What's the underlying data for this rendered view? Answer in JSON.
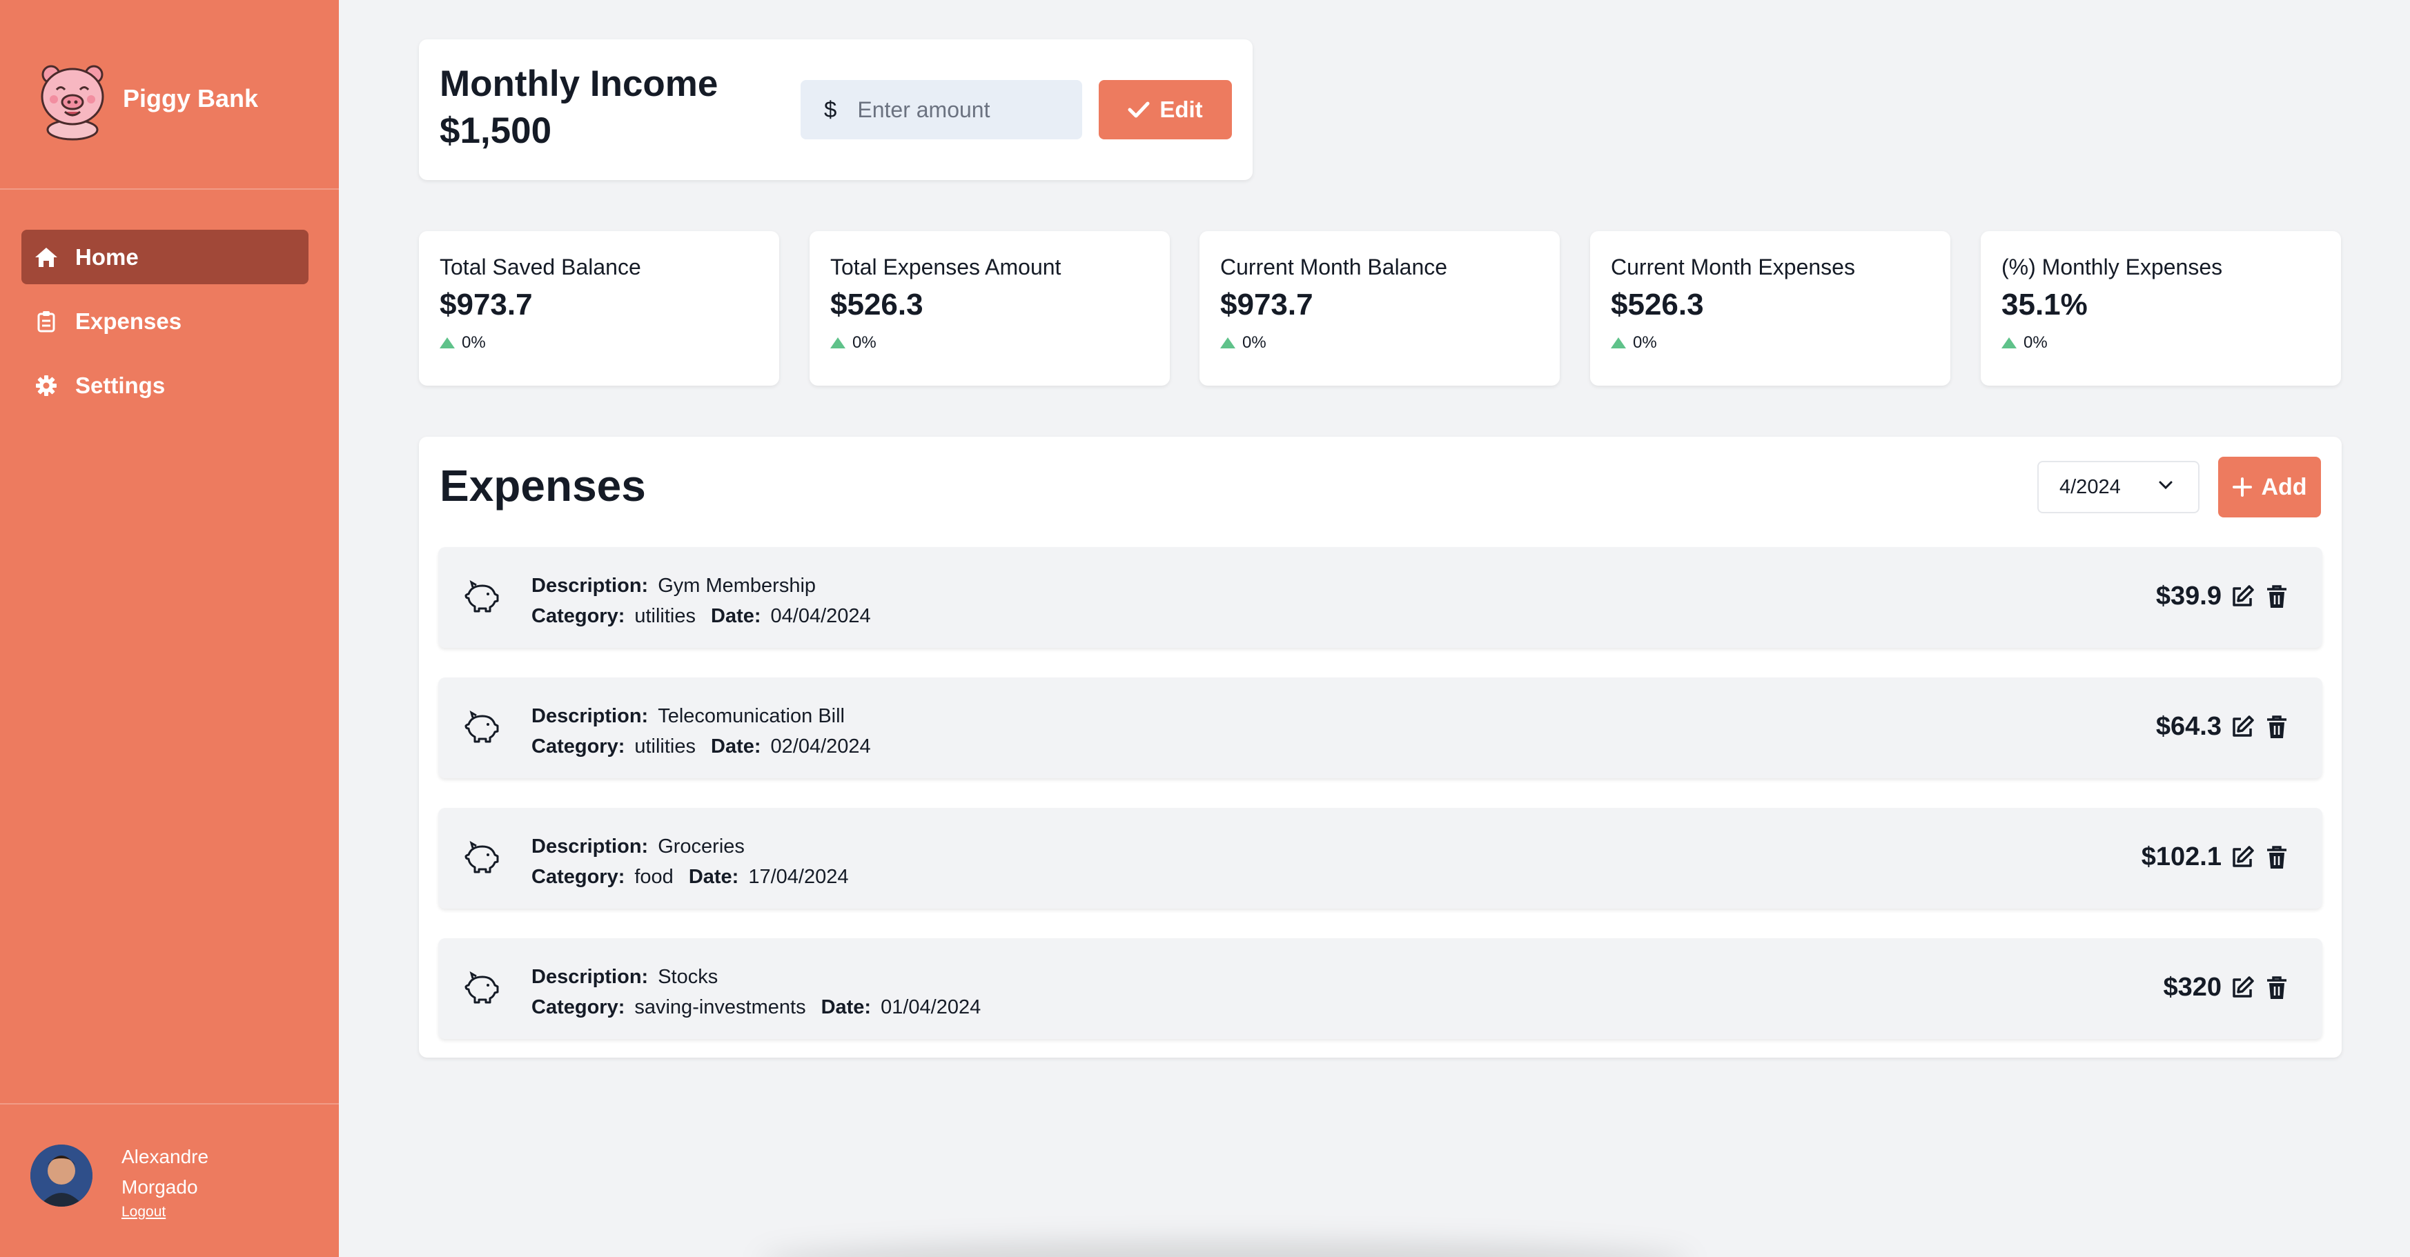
{
  "app": {
    "name": "Piggy Bank"
  },
  "nav": [
    {
      "label": "Home",
      "icon": "home-icon",
      "active": true
    },
    {
      "label": "Expenses",
      "icon": "clipboard-icon",
      "active": false
    },
    {
      "label": "Settings",
      "icon": "gear-icon",
      "active": false
    }
  ],
  "user": {
    "first_name": "Alexandre",
    "last_name": "Morgado",
    "logout_label": "Logout"
  },
  "income": {
    "title": "Monthly Income",
    "value": "$1,500",
    "currency_symbol": "$",
    "placeholder": "Enter amount",
    "edit_label": "Edit"
  },
  "stats": [
    {
      "label": "Total Saved Balance",
      "value": "$973.7",
      "change": "0%"
    },
    {
      "label": "Total Expenses Amount",
      "value": "$526.3",
      "change": "0%"
    },
    {
      "label": "Current Month Balance",
      "value": "$973.7",
      "change": "0%"
    },
    {
      "label": "Current Month Expenses",
      "value": "$526.3",
      "change": "0%"
    },
    {
      "label": "(%) Monthly Expenses",
      "value": "35.1%",
      "change": "0%"
    }
  ],
  "expenses": {
    "title": "Expenses",
    "selected_month": "4/2024",
    "add_label": "Add",
    "field_labels": {
      "description": "Description:",
      "category": "Category:",
      "date": "Date:"
    },
    "items": [
      {
        "description": "Gym Membership",
        "category": "utilities",
        "date": "04/04/2024",
        "amount": "$39.9"
      },
      {
        "description": "Telecomunication Bill",
        "category": "utilities",
        "date": "02/04/2024",
        "amount": "$64.3"
      },
      {
        "description": "Groceries",
        "category": "food",
        "date": "17/04/2024",
        "amount": "$102.1"
      },
      {
        "description": "Stocks",
        "category": "saving-investments",
        "date": "01/04/2024",
        "amount": "$320"
      }
    ]
  },
  "colors": {
    "accent": "#ed7b5f",
    "active_nav": "#a14838",
    "positive": "#5fc28a",
    "background": "#f2f3f5"
  }
}
